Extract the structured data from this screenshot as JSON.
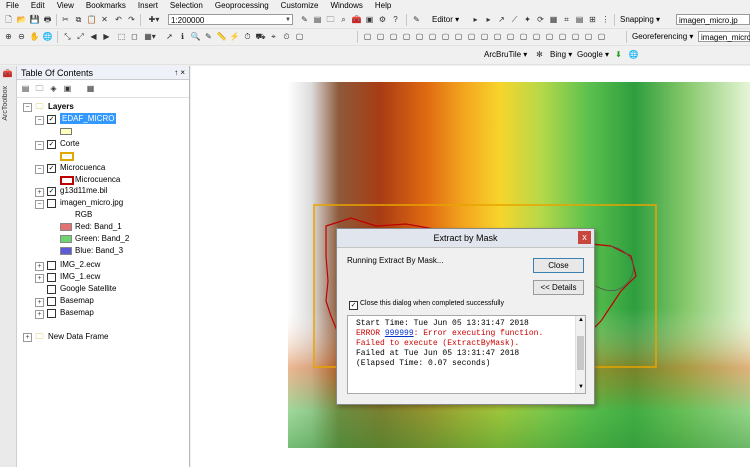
{
  "menu": [
    "File",
    "Edit",
    "View",
    "Bookmarks",
    "Insert",
    "Selection",
    "Geoprocessing",
    "Customize",
    "Windows",
    "Help"
  ],
  "toolbar1": {
    "scale": "1:200000",
    "editor": "Editor ▾",
    "snapping": "Snapping ▾",
    "layer_combo": "imagen_micro.jp"
  },
  "toolbar2": {
    "georeferencing": "Georeferencing ▾",
    "geo_layer": "imagen_micro.jp"
  },
  "toolbar3": {
    "arcbrutile": "ArcBruTile ▾",
    "bing": "Bing ▾",
    "google": "Google ▾"
  },
  "strip": {
    "label": "ArcToolbox"
  },
  "toc": {
    "title": "Table Of Contents",
    "pin": "↑ ×",
    "layers_root": "Layers",
    "items": [
      {
        "label": "EDAF_MICRO",
        "checked": true,
        "selected": true
      },
      {
        "label": "Corte",
        "checked": true
      },
      {
        "label": "Microcuenca",
        "checked": true
      },
      {
        "label": "Microcuenca"
      },
      {
        "label": "g13d11me.bil",
        "checked": true
      },
      {
        "label": "imagen_micro.jpg",
        "checked": false
      },
      {
        "label": "RGB"
      },
      {
        "label": "Red:   Band_1"
      },
      {
        "label": "Green:  Band_2"
      },
      {
        "label": "Blue:   Band_3"
      },
      {
        "label": "IMG_2.ecw",
        "checked": false
      },
      {
        "label": "IMG_1.ecw",
        "checked": false
      },
      {
        "label": "Google Satellite",
        "checked": false
      },
      {
        "label": "Basemap",
        "checked": false
      },
      {
        "label": "Basemap",
        "checked": false
      },
      {
        "label": "New Data Frame"
      }
    ]
  },
  "dialog": {
    "title": "Extract by Mask",
    "close_x": "x",
    "status": "Running Extract By Mask...",
    "close_btn": "Close",
    "details_btn": "<< Details",
    "checkbox_label": "Close this dialog when completed successfully",
    "log_line1": "Start Time: Tue Jun 05 13:31:47 2018",
    "log_error_prefix": "ERROR ",
    "log_error_code": "999999",
    "log_error_rest": ": Error executing function.",
    "log_line3": "Failed to execute (ExtractByMask).",
    "log_line4": "Failed at Tue Jun 05 13:31:47 2018",
    "log_line5": "(Elapsed Time: 0.07 seconds)"
  },
  "colors": {
    "error": "#cc0000",
    "link": "#0033cc",
    "selection": "#3399ff"
  }
}
